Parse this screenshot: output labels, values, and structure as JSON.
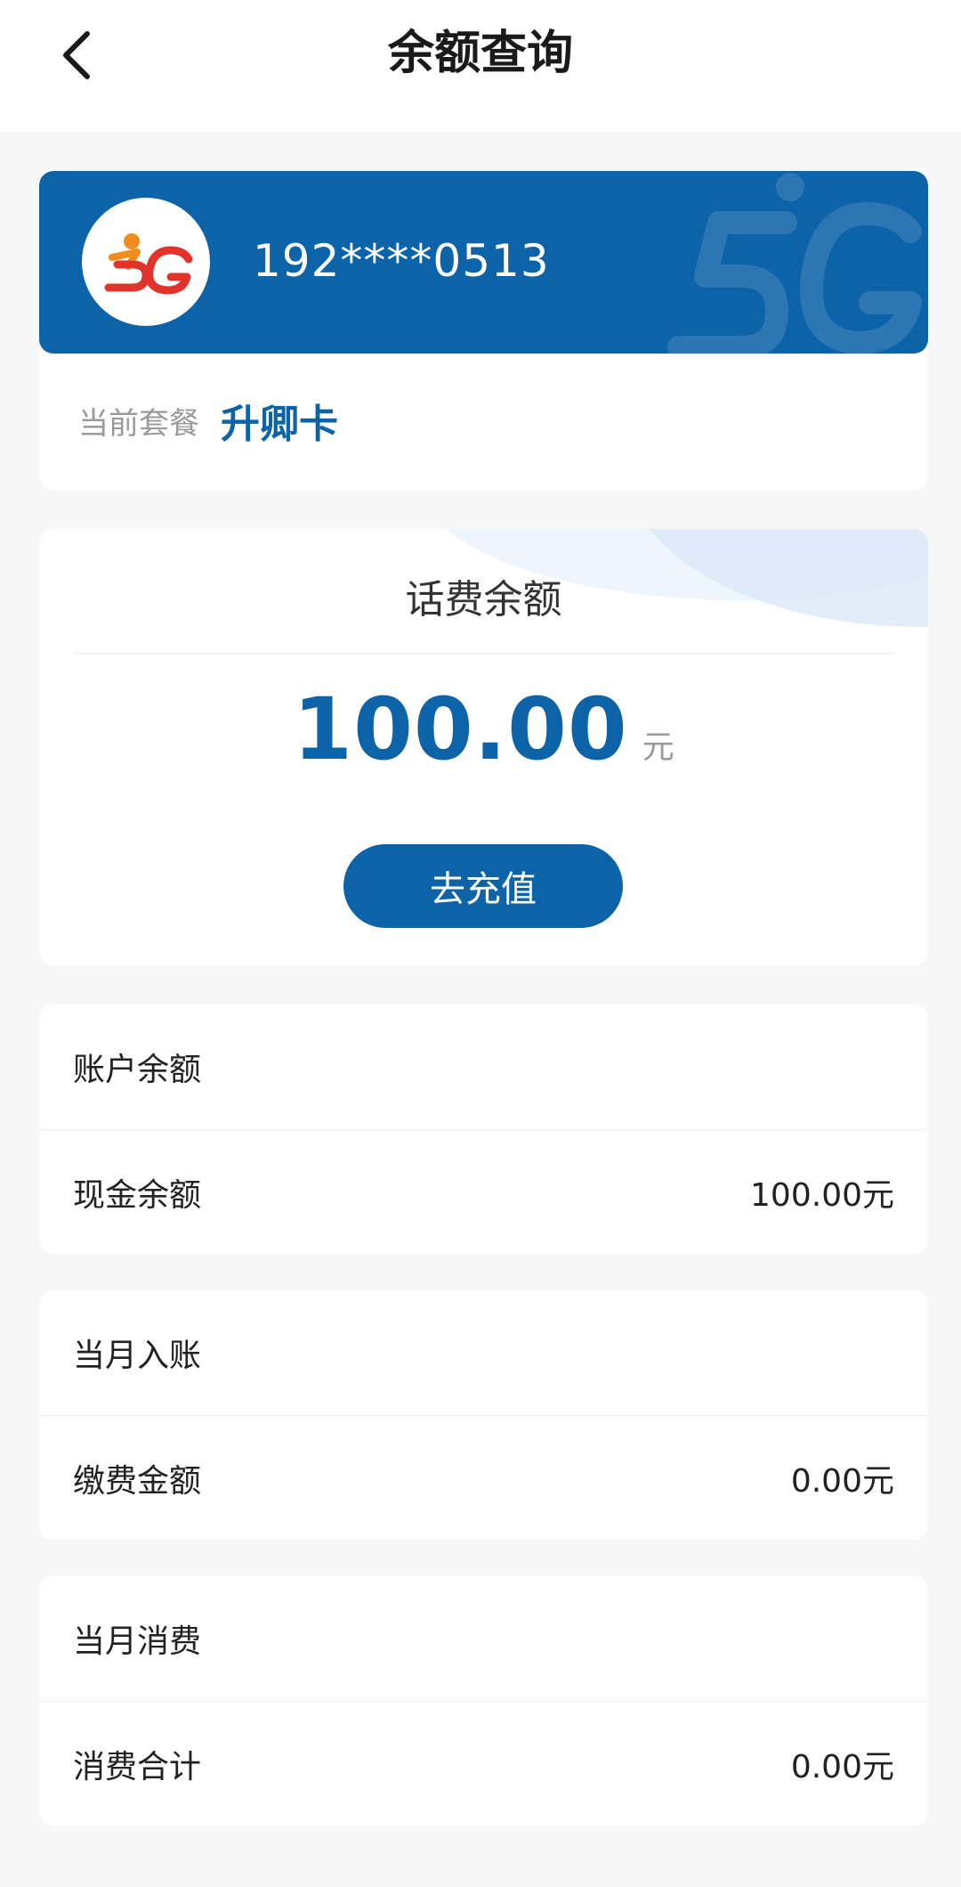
{
  "header": {
    "title": "余额查询"
  },
  "account": {
    "phone": "192****0513",
    "plan_label": "当前套餐",
    "plan_name": "升卿卡"
  },
  "balance": {
    "title": "话费余额",
    "amount": "100.00",
    "unit": "元",
    "recharge_label": "去充值"
  },
  "sections": [
    {
      "title": "账户余额",
      "row_label": "现金余额",
      "row_value": "100.00元"
    },
    {
      "title": "当月入账",
      "row_label": "缴费金额",
      "row_value": "0.00元"
    },
    {
      "title": "当月消费",
      "row_label": "消费合计",
      "row_value": "0.00元"
    }
  ],
  "colors": {
    "brand_blue": "#0d63a8",
    "logo_red": "#e2332b",
    "logo_orange": "#f08c1e",
    "background": "#f7f7f8"
  }
}
